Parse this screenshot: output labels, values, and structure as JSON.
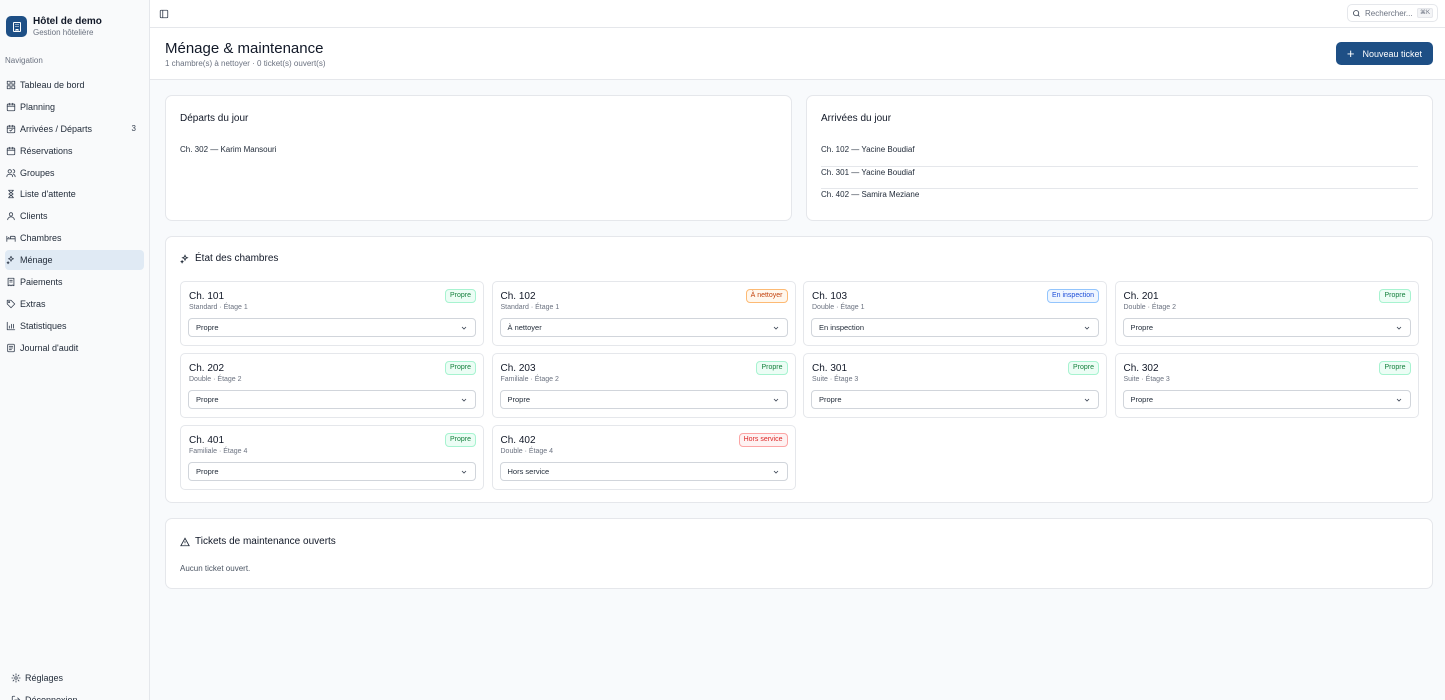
{
  "brand": {
    "title": "Hôtel de demo",
    "subtitle": "Gestion hôtelière"
  },
  "sidebar": {
    "heading": "Navigation",
    "items": [
      {
        "label": "Tableau de bord",
        "icon": "dashboard-icon"
      },
      {
        "label": "Planning",
        "icon": "calendar-icon"
      },
      {
        "label": "Arrivées / Départs",
        "icon": "calendar-check-icon",
        "badge": "3"
      },
      {
        "label": "Réservations",
        "icon": "calendar-icon"
      },
      {
        "label": "Groupes",
        "icon": "users-icon"
      },
      {
        "label": "Liste d'attente",
        "icon": "hourglass-icon"
      },
      {
        "label": "Clients",
        "icon": "user-icon"
      },
      {
        "label": "Chambres",
        "icon": "bed-icon"
      },
      {
        "label": "Ménage",
        "icon": "sparkles-icon",
        "active": true
      },
      {
        "label": "Paiements",
        "icon": "receipt-icon"
      },
      {
        "label": "Extras",
        "icon": "tag-icon"
      },
      {
        "label": "Statistiques",
        "icon": "chart-icon"
      },
      {
        "label": "Journal d'audit",
        "icon": "log-icon"
      }
    ],
    "bottom": [
      {
        "label": "Réglages",
        "icon": "gear-icon"
      },
      {
        "label": "Déconnexion",
        "icon": "logout-icon"
      }
    ]
  },
  "topbar": {
    "search_placeholder": "Rechercher...",
    "shortcut": "⌘K"
  },
  "header": {
    "title": "Ménage & maintenance",
    "subtitle": "1 chambre(s) à nettoyer · 0 ticket(s) ouvert(s)",
    "new_ticket": "Nouveau ticket"
  },
  "departures": {
    "title": "Départs du jour",
    "items": [
      "Ch. 302 — Karim Mansouri"
    ]
  },
  "arrivals": {
    "title": "Arrivées du jour",
    "items": [
      "Ch. 102 — Yacine Boudiaf",
      "Ch. 301 — Yacine Boudiaf",
      "Ch. 402 — Samira Meziane"
    ]
  },
  "rooms": {
    "title": "État des chambres",
    "list": [
      {
        "name": "Ch. 101",
        "meta": "Standard · Étage 1",
        "status": "Propre",
        "kind": "clean"
      },
      {
        "name": "Ch. 102",
        "meta": "Standard · Étage 1",
        "status": "À nettoyer",
        "kind": "dirty"
      },
      {
        "name": "Ch. 103",
        "meta": "Double · Étage 1",
        "status": "En inspection",
        "kind": "inspect"
      },
      {
        "name": "Ch. 201",
        "meta": "Double · Étage 2",
        "status": "Propre",
        "kind": "clean"
      },
      {
        "name": "Ch. 202",
        "meta": "Double · Étage 2",
        "status": "Propre",
        "kind": "clean"
      },
      {
        "name": "Ch. 203",
        "meta": "Familiale · Étage 2",
        "status": "Propre",
        "kind": "clean"
      },
      {
        "name": "Ch. 301",
        "meta": "Suite · Étage 3",
        "status": "Propre",
        "kind": "clean"
      },
      {
        "name": "Ch. 302",
        "meta": "Suite · Étage 3",
        "status": "Propre",
        "kind": "clean"
      },
      {
        "name": "Ch. 401",
        "meta": "Familiale · Étage 4",
        "status": "Propre",
        "kind": "clean"
      },
      {
        "name": "Ch. 402",
        "meta": "Double · Étage 4",
        "status": "Hors service",
        "kind": "oos"
      }
    ]
  },
  "tickets": {
    "title": "Tickets de maintenance ouverts",
    "empty": "Aucun ticket ouvert."
  },
  "colors": {
    "accent": "#1e4f85",
    "clean": {
      "fg": "#15803d",
      "bg": "#ecfdf5",
      "border": "#a7f3d0"
    },
    "dirty": {
      "fg": "#c2410c",
      "bg": "#fff7ed",
      "border": "#fdba74"
    },
    "inspect": {
      "fg": "#1d4ed8",
      "bg": "#eff6ff",
      "border": "#93c5fd"
    },
    "oos": {
      "fg": "#dc2626",
      "bg": "#fef2f2",
      "border": "#fca5a5"
    }
  }
}
